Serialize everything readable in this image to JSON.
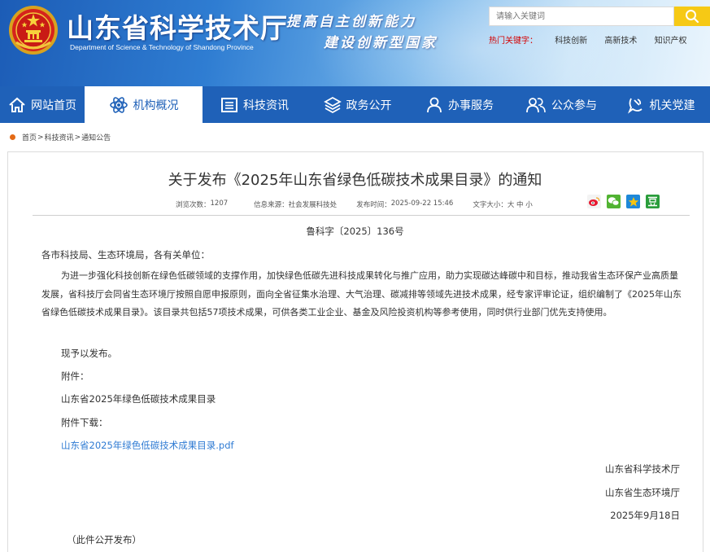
{
  "header": {
    "title_cn": "山东省科学技术厅",
    "title_en": "Department of Science & Technology of Shandong Province",
    "slogan_line1": "提高自主创新能力",
    "slogan_line2": "建设创新型国家",
    "search_placeholder": "请输入关键词",
    "hotwords_label": "热门关键字：",
    "hotwords": [
      "科技创新",
      "高新技术",
      "知识产权"
    ]
  },
  "nav": {
    "items": [
      {
        "label": "网站首页",
        "icon": "home-icon"
      },
      {
        "label": "机构概况",
        "icon": "atom-icon"
      },
      {
        "label": "科技资讯",
        "icon": "newspaper-icon"
      },
      {
        "label": "政务公开",
        "icon": "layers-icon"
      },
      {
        "label": "办事服务",
        "icon": "person-icon"
      },
      {
        "label": "公众参与",
        "icon": "people-icon"
      },
      {
        "label": "机关党建",
        "icon": "party-icon"
      }
    ],
    "active_index": 1
  },
  "breadcrumb": {
    "items": [
      "首页",
      "科技资讯",
      "通知公告"
    ],
    "separator": ">"
  },
  "article": {
    "title": "关于发布《2025年山东省绿色低碳技术成果目录》的通知",
    "meta": {
      "views_label": "浏览次数：",
      "views": "1207",
      "source_label": "信息来源：",
      "source": "社会发展科技处",
      "time_label": "发布时间：",
      "time": "2025-09-22 15:46",
      "fontsize_label": "文字大小：",
      "fontsize_options": "大 中 小"
    },
    "doc_number": "鲁科字〔2025〕136号",
    "salutation": "各市科技局、生态环境局，各有关单位：",
    "paragraph1": "为进一步强化科技创新在绿色低碳领域的支撑作用，加快绿色低碳先进科技成果转化与推广应用，助力实现碳达峰碳中和目标，推动我省生态环保产业高质量发展，省科技厅会同省生态环境厅按照自愿申报原则，面向全省征集水治理、大气治理、碳减排等领域先进技术成果，经专家评审论证，组织编制了《2025年山东省绿色低碳技术成果目录》。该目录共包括57项技术成果，可供各类工业企业、基金及风险投资机构等参考使用，同时供行业部门优先支持使用。",
    "line_publish": "现予以发布。",
    "line_attachment_label": "附件：",
    "line_attachment_name": "山东省2025年绿色低碳技术成果目录",
    "line_download_label": "附件下载：",
    "line_download_link": "山东省2025年绿色低碳技术成果目录.pdf",
    "signer1": "山东省科学技术厅",
    "signer2": "山东省生态环境厅",
    "date": "2025年9月18日",
    "footnote": "（此件公开发布）"
  },
  "colors": {
    "nav_bg": "#1f61b8",
    "search_button": "#f6c915",
    "hot_label": "#d40000",
    "link": "#2f7bd3",
    "breadcrumb_dot": "#e46a15"
  }
}
